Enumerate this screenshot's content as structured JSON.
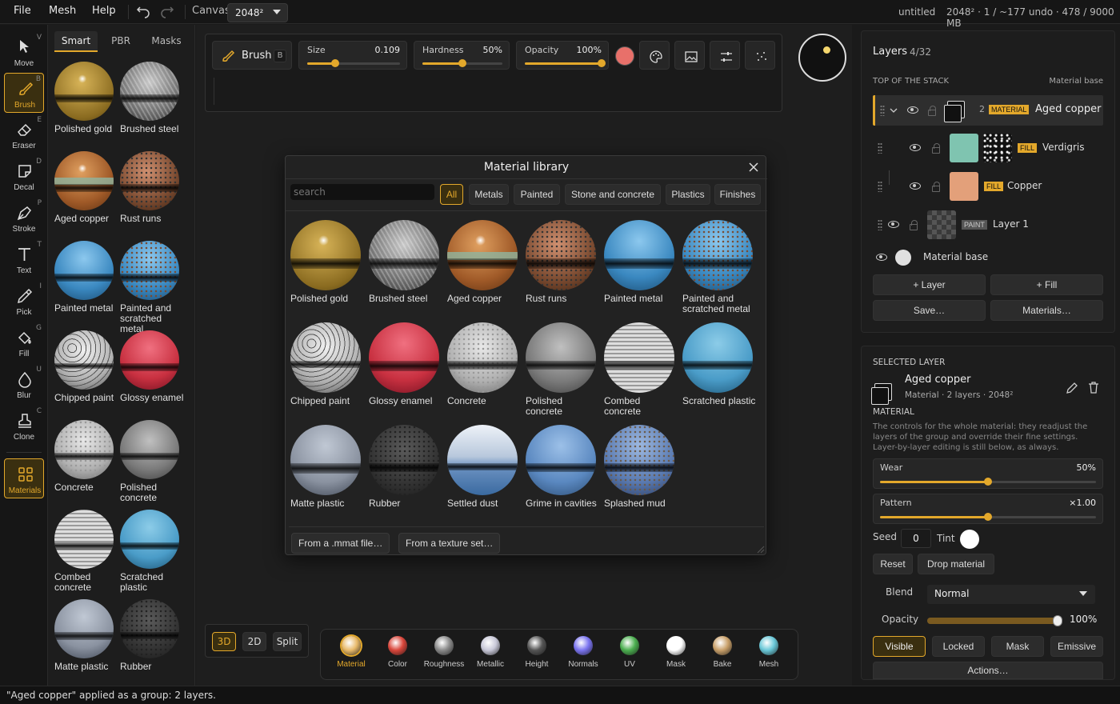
{
  "menu": {
    "file": "File",
    "mesh": "Mesh",
    "help": "Help",
    "canvas_label": "Canvas",
    "canvas_value": "2048²",
    "doc": "untitled",
    "stats": "2048² · 1 / ~177 undo · 478 / 9000 MB"
  },
  "tools": [
    {
      "label": "Move",
      "key": "V"
    },
    {
      "label": "Brush",
      "key": "B"
    },
    {
      "label": "Eraser",
      "key": "E"
    },
    {
      "label": "Decal",
      "key": "D"
    },
    {
      "label": "Stroke",
      "key": "P"
    },
    {
      "label": "Text",
      "key": "T"
    },
    {
      "label": "Pick",
      "key": "I"
    },
    {
      "label": "Fill",
      "key": "G"
    },
    {
      "label": "Blur",
      "key": "U"
    },
    {
      "label": "Clone",
      "key": "C"
    },
    {
      "label": "Materials",
      "key": ""
    }
  ],
  "panel_tabs": [
    "Smart",
    "PBR",
    "Masks"
  ],
  "side_materials": [
    "Polished gold",
    "Brushed steel",
    "Aged copper",
    "Rust runs",
    "Painted metal",
    "Painted and scratched metal",
    "Chipped paint",
    "Glossy enamel",
    "Concrete",
    "Polished concrete",
    "Combed concrete",
    "Scratched plastic",
    "Matte plastic",
    "Rubber"
  ],
  "brush": {
    "name": "Brush",
    "key": "B",
    "size_label": "Size",
    "size_value": "0.109",
    "size_level": 0.3,
    "hardness_label": "Hardness",
    "hardness_value": "50%",
    "hardness_level": 0.5,
    "opacity_label": "Opacity",
    "opacity_value": "100%",
    "opacity_level": 1.0,
    "color": "#e8706a"
  },
  "library": {
    "title": "Material library",
    "search_placeholder": "search",
    "filters": [
      "All",
      "Metals",
      "Painted",
      "Stone and concrete",
      "Plastics",
      "Finishes"
    ],
    "items": [
      "Polished gold",
      "Brushed steel",
      "Aged copper",
      "Rust runs",
      "Painted metal",
      "Painted and scratched metal",
      "Chipped paint",
      "Glossy enamel",
      "Concrete",
      "Polished concrete",
      "Combed concrete",
      "Scratched plastic",
      "Matte plastic",
      "Rubber",
      "Settled dust",
      "Grime in cavities",
      "Splashed mud"
    ],
    "from_mmat": "From a .mmat file…",
    "from_texture": "From a texture set…"
  },
  "view_modes": [
    "3D",
    "2D",
    "Split"
  ],
  "channels": [
    {
      "label": "Material",
      "color": "#e8b96a"
    },
    {
      "label": "Color",
      "color": "#d9463b"
    },
    {
      "label": "Roughness",
      "color": "#8a8a8a"
    },
    {
      "label": "Metallic",
      "color": "#c8c8d8"
    },
    {
      "label": "Height",
      "color": "#555555"
    },
    {
      "label": "Normals",
      "color": "#7b74f0"
    },
    {
      "label": "UV",
      "color": "#4caf50"
    },
    {
      "label": "Mask",
      "color": "#ffffff"
    },
    {
      "label": "Bake",
      "color": "#c9a06a"
    },
    {
      "label": "Mesh",
      "color": "#6ac8d8"
    }
  ],
  "layers": {
    "title": "Layers",
    "count": "4/32",
    "top": "TOP OF THE STACK",
    "base": "Material base",
    "group": {
      "num": "2",
      "tag": "MATERIAL",
      "name": "Aged copper"
    },
    "fill1": {
      "tag": "FILL",
      "name": "Verdigris",
      "color": "#7fc4b0"
    },
    "fill2": {
      "tag": "FILL",
      "name": "Copper",
      "color": "#e3a07a"
    },
    "paint": {
      "tag": "PAINT",
      "name": "Layer 1"
    },
    "add_layer": "+ Layer",
    "add_fill": "+ Fill",
    "save": "Save…",
    "materials": "Materials…"
  },
  "selected": {
    "header": "SELECTED LAYER",
    "name": "Aged copper",
    "meta": "Material · 2 layers · 2048²",
    "section": "MATERIAL",
    "desc": "The controls for the whole material: they readjust the layers of the group and override their fine settings. Layer-by-layer editing is still below, as always.",
    "wear_label": "Wear",
    "wear_value": "50%",
    "wear_level": 0.5,
    "pattern_label": "Pattern",
    "pattern_value": "×1.00",
    "pattern_level": 0.5,
    "seed_label": "Seed",
    "seed_value": "0",
    "tint_label": "Tint",
    "reset": "Reset",
    "drop": "Drop material",
    "blend_label": "Blend",
    "blend_value": "Normal",
    "opacity_label": "Opacity",
    "opacity_value": "100%",
    "opacity_level": 1.0,
    "visible": "Visible",
    "locked": "Locked",
    "mask": "Mask",
    "emissive": "Emissive",
    "actions": "Actions…"
  },
  "status": "\"Aged copper\" applied as a group: 2 layers."
}
